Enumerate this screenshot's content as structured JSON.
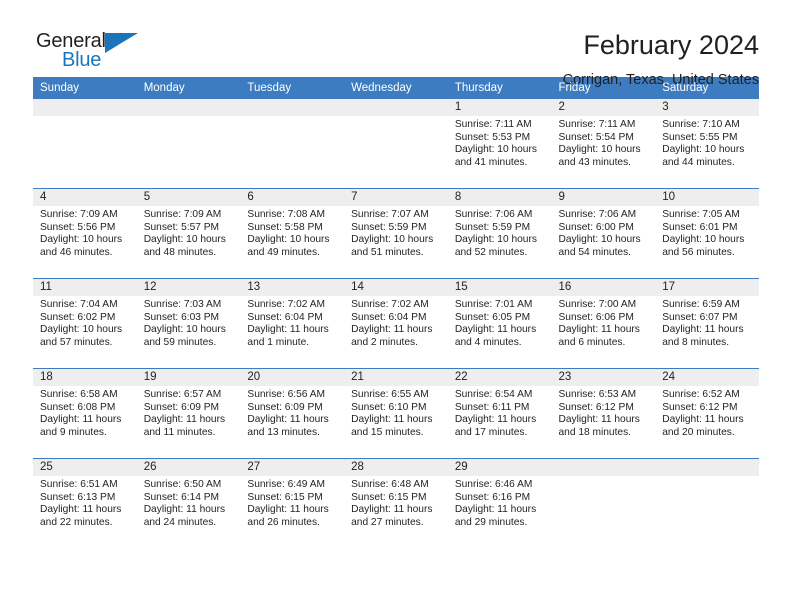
{
  "brand": {
    "word_one": "General",
    "word_two": "Blue",
    "accent_color": "#1b75bc"
  },
  "header": {
    "title": "February 2024",
    "subtitle": "Corrigan, Texas, United States"
  },
  "theme": {
    "header_row_bg": "#3d7cc0",
    "daynum_band_bg": "#eeeeee",
    "text_color": "#231f20"
  },
  "weekday_headers": [
    "Sunday",
    "Monday",
    "Tuesday",
    "Wednesday",
    "Thursday",
    "Friday",
    "Saturday"
  ],
  "labels": {
    "sunrise_prefix": "Sunrise: ",
    "sunset_prefix": "Sunset: ",
    "daylight_prefix": "Daylight: "
  },
  "weeks": [
    [
      {
        "day": "",
        "empty": true
      },
      {
        "day": "",
        "empty": true
      },
      {
        "day": "",
        "empty": true
      },
      {
        "day": "",
        "empty": true
      },
      {
        "day": "1",
        "sunrise": "Sunrise: 7:11 AM",
        "sunset": "Sunset: 5:53 PM",
        "daylight": "Daylight: 10 hours and 41 minutes."
      },
      {
        "day": "2",
        "sunrise": "Sunrise: 7:11 AM",
        "sunset": "Sunset: 5:54 PM",
        "daylight": "Daylight: 10 hours and 43 minutes."
      },
      {
        "day": "3",
        "sunrise": "Sunrise: 7:10 AM",
        "sunset": "Sunset: 5:55 PM",
        "daylight": "Daylight: 10 hours and 44 minutes."
      }
    ],
    [
      {
        "day": "4",
        "sunrise": "Sunrise: 7:09 AM",
        "sunset": "Sunset: 5:56 PM",
        "daylight": "Daylight: 10 hours and 46 minutes."
      },
      {
        "day": "5",
        "sunrise": "Sunrise: 7:09 AM",
        "sunset": "Sunset: 5:57 PM",
        "daylight": "Daylight: 10 hours and 48 minutes."
      },
      {
        "day": "6",
        "sunrise": "Sunrise: 7:08 AM",
        "sunset": "Sunset: 5:58 PM",
        "daylight": "Daylight: 10 hours and 49 minutes."
      },
      {
        "day": "7",
        "sunrise": "Sunrise: 7:07 AM",
        "sunset": "Sunset: 5:59 PM",
        "daylight": "Daylight: 10 hours and 51 minutes."
      },
      {
        "day": "8",
        "sunrise": "Sunrise: 7:06 AM",
        "sunset": "Sunset: 5:59 PM",
        "daylight": "Daylight: 10 hours and 52 minutes."
      },
      {
        "day": "9",
        "sunrise": "Sunrise: 7:06 AM",
        "sunset": "Sunset: 6:00 PM",
        "daylight": "Daylight: 10 hours and 54 minutes."
      },
      {
        "day": "10",
        "sunrise": "Sunrise: 7:05 AM",
        "sunset": "Sunset: 6:01 PM",
        "daylight": "Daylight: 10 hours and 56 minutes."
      }
    ],
    [
      {
        "day": "11",
        "sunrise": "Sunrise: 7:04 AM",
        "sunset": "Sunset: 6:02 PM",
        "daylight": "Daylight: 10 hours and 57 minutes."
      },
      {
        "day": "12",
        "sunrise": "Sunrise: 7:03 AM",
        "sunset": "Sunset: 6:03 PM",
        "daylight": "Daylight: 10 hours and 59 minutes."
      },
      {
        "day": "13",
        "sunrise": "Sunrise: 7:02 AM",
        "sunset": "Sunset: 6:04 PM",
        "daylight": "Daylight: 11 hours and 1 minute."
      },
      {
        "day": "14",
        "sunrise": "Sunrise: 7:02 AM",
        "sunset": "Sunset: 6:04 PM",
        "daylight": "Daylight: 11 hours and 2 minutes."
      },
      {
        "day": "15",
        "sunrise": "Sunrise: 7:01 AM",
        "sunset": "Sunset: 6:05 PM",
        "daylight": "Daylight: 11 hours and 4 minutes."
      },
      {
        "day": "16",
        "sunrise": "Sunrise: 7:00 AM",
        "sunset": "Sunset: 6:06 PM",
        "daylight": "Daylight: 11 hours and 6 minutes."
      },
      {
        "day": "17",
        "sunrise": "Sunrise: 6:59 AM",
        "sunset": "Sunset: 6:07 PM",
        "daylight": "Daylight: 11 hours and 8 minutes."
      }
    ],
    [
      {
        "day": "18",
        "sunrise": "Sunrise: 6:58 AM",
        "sunset": "Sunset: 6:08 PM",
        "daylight": "Daylight: 11 hours and 9 minutes."
      },
      {
        "day": "19",
        "sunrise": "Sunrise: 6:57 AM",
        "sunset": "Sunset: 6:09 PM",
        "daylight": "Daylight: 11 hours and 11 minutes."
      },
      {
        "day": "20",
        "sunrise": "Sunrise: 6:56 AM",
        "sunset": "Sunset: 6:09 PM",
        "daylight": "Daylight: 11 hours and 13 minutes."
      },
      {
        "day": "21",
        "sunrise": "Sunrise: 6:55 AM",
        "sunset": "Sunset: 6:10 PM",
        "daylight": "Daylight: 11 hours and 15 minutes."
      },
      {
        "day": "22",
        "sunrise": "Sunrise: 6:54 AM",
        "sunset": "Sunset: 6:11 PM",
        "daylight": "Daylight: 11 hours and 17 minutes."
      },
      {
        "day": "23",
        "sunrise": "Sunrise: 6:53 AM",
        "sunset": "Sunset: 6:12 PM",
        "daylight": "Daylight: 11 hours and 18 minutes."
      },
      {
        "day": "24",
        "sunrise": "Sunrise: 6:52 AM",
        "sunset": "Sunset: 6:12 PM",
        "daylight": "Daylight: 11 hours and 20 minutes."
      }
    ],
    [
      {
        "day": "25",
        "sunrise": "Sunrise: 6:51 AM",
        "sunset": "Sunset: 6:13 PM",
        "daylight": "Daylight: 11 hours and 22 minutes."
      },
      {
        "day": "26",
        "sunrise": "Sunrise: 6:50 AM",
        "sunset": "Sunset: 6:14 PM",
        "daylight": "Daylight: 11 hours and 24 minutes."
      },
      {
        "day": "27",
        "sunrise": "Sunrise: 6:49 AM",
        "sunset": "Sunset: 6:15 PM",
        "daylight": "Daylight: 11 hours and 26 minutes."
      },
      {
        "day": "28",
        "sunrise": "Sunrise: 6:48 AM",
        "sunset": "Sunset: 6:15 PM",
        "daylight": "Daylight: 11 hours and 27 minutes."
      },
      {
        "day": "29",
        "sunrise": "Sunrise: 6:46 AM",
        "sunset": "Sunset: 6:16 PM",
        "daylight": "Daylight: 11 hours and 29 minutes."
      },
      {
        "day": "",
        "empty": true
      },
      {
        "day": "",
        "empty": true
      }
    ]
  ]
}
